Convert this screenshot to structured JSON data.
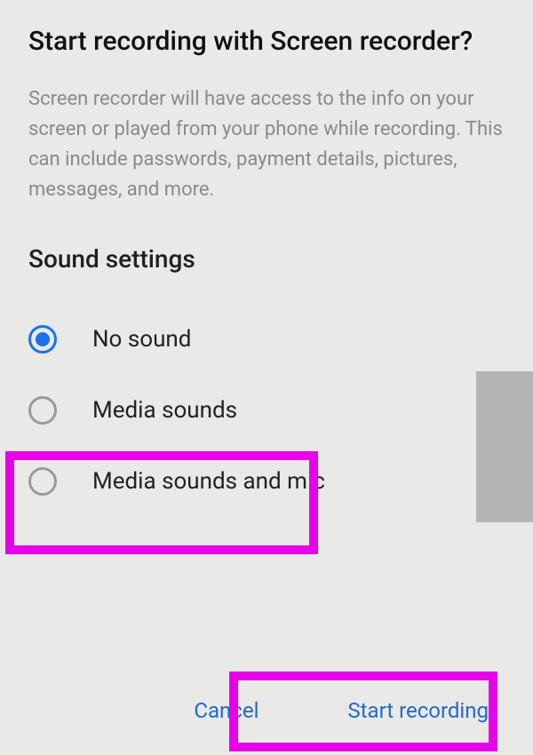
{
  "dialog": {
    "title": "Start recording with Screen recorder?",
    "description": "Screen recorder will have access to the info on your screen or played from your phone while recording. This can include passwords, payment details, pictures, messages, and more.",
    "section_heading": "Sound settings",
    "options": [
      {
        "label": "No sound",
        "selected": true
      },
      {
        "label": "Media sounds",
        "selected": false
      },
      {
        "label": "Media sounds and mic",
        "selected": false
      }
    ],
    "buttons": {
      "cancel": "Cancel",
      "start": "Start recording"
    }
  }
}
